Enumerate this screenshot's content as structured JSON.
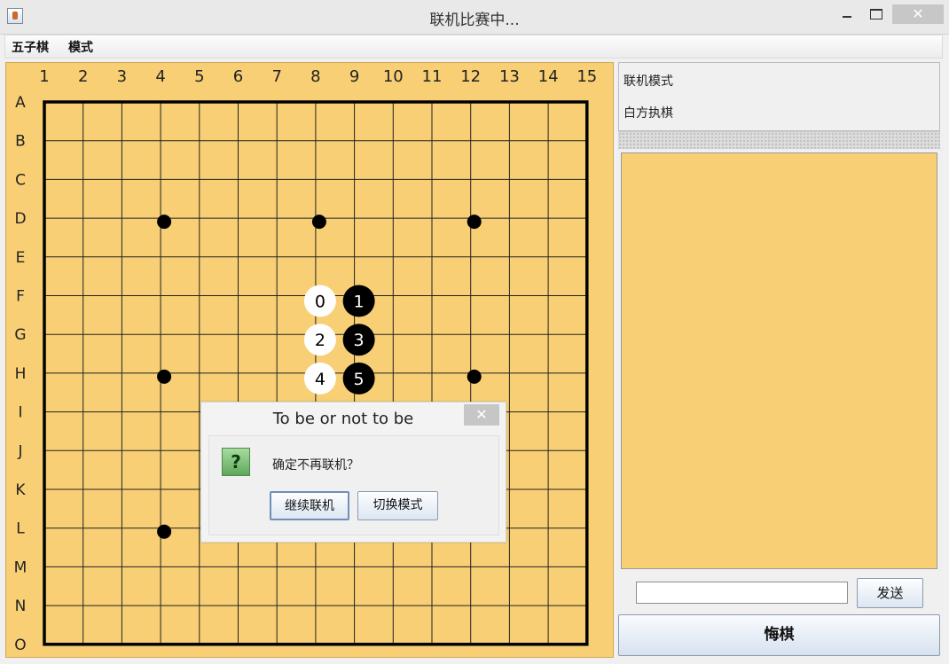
{
  "window": {
    "title": "联机比赛中...",
    "close_glyph": "✕"
  },
  "menubar": {
    "items": [
      "五子棋",
      "模式"
    ]
  },
  "board": {
    "column_labels": [
      "1",
      "2",
      "3",
      "4",
      "5",
      "6",
      "7",
      "8",
      "9",
      "10",
      "11",
      "12",
      "13",
      "14",
      "15"
    ],
    "row_labels": [
      "A",
      "B",
      "C",
      "D",
      "E",
      "F",
      "G",
      "H",
      "I",
      "J",
      "K",
      "L",
      "M",
      "N",
      "O"
    ],
    "board_color": "#f8cf74",
    "star_points": [
      {
        "row": "D",
        "col": 4
      },
      {
        "row": "D",
        "col": 8
      },
      {
        "row": "D",
        "col": 12
      },
      {
        "row": "H",
        "col": 4
      },
      {
        "row": "H",
        "col": 12
      },
      {
        "row": "L",
        "col": 4
      }
    ],
    "stones": [
      {
        "row": "F",
        "col": 8,
        "color": "white",
        "label": "0"
      },
      {
        "row": "F",
        "col": 9,
        "color": "black",
        "label": "1"
      },
      {
        "row": "G",
        "col": 8,
        "color": "white",
        "label": "2"
      },
      {
        "row": "G",
        "col": 9,
        "color": "black",
        "label": "3"
      },
      {
        "row": "H",
        "col": 8,
        "color": "white",
        "label": "4"
      },
      {
        "row": "H",
        "col": 9,
        "color": "black",
        "label": "5"
      }
    ]
  },
  "side_panel": {
    "mode_text": "联机模式",
    "turn_text": "白方执棋",
    "chat_input_value": "",
    "send_label": "发送",
    "regret_label": "悔棋"
  },
  "dialog": {
    "title": "To be or not to be",
    "close_glyph": "✕",
    "icon_glyph": "?",
    "message": "确定不再联机？",
    "continue_label": "继续联机",
    "switch_label": "切换模式"
  }
}
